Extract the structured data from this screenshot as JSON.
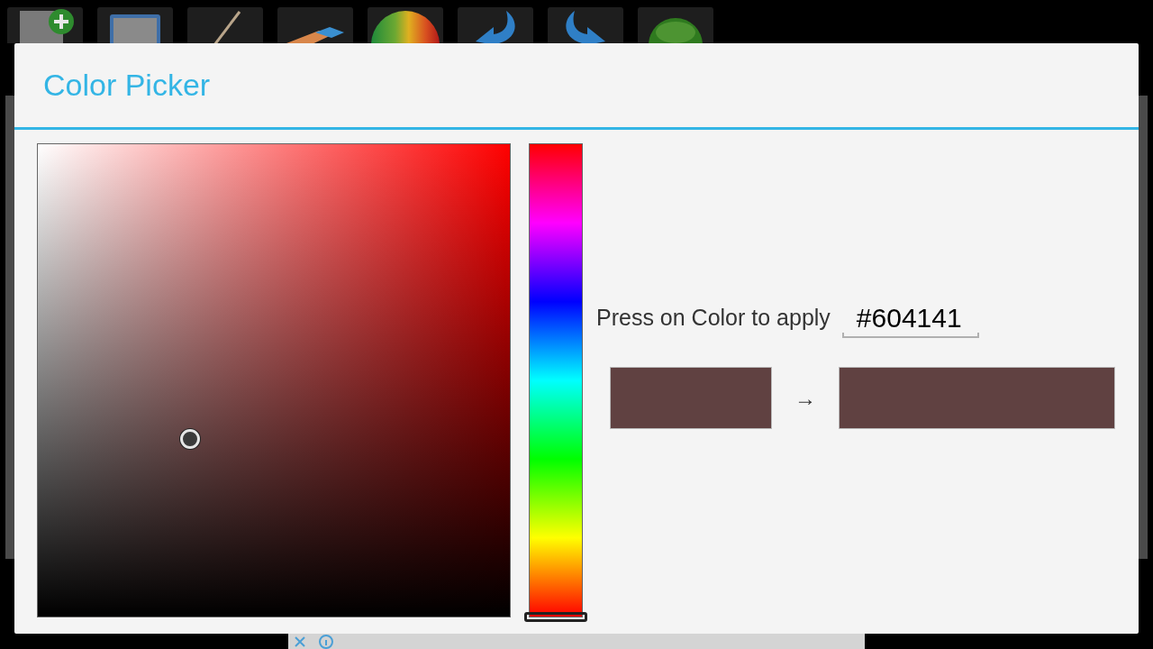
{
  "dialog": {
    "title": "Color Picker",
    "hue_slider": {
      "level": 0
    },
    "hint": "Press on Color to apply",
    "hex_input": {
      "value": "#604141"
    },
    "swatches": [
      {
        "kind": "old",
        "color": "#604141"
      },
      {
        "kind": "new",
        "color": "#604141"
      }
    ],
    "arrow": "→"
  }
}
